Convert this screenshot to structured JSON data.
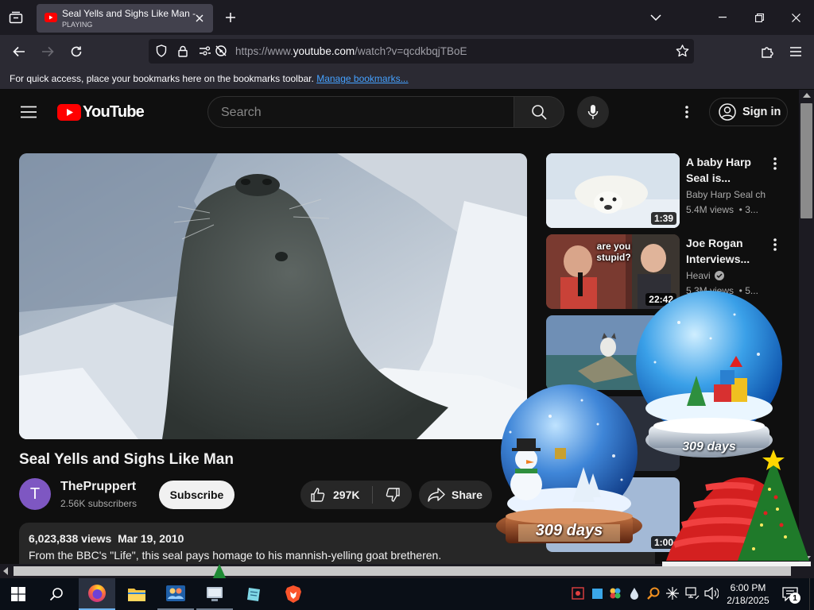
{
  "browser": {
    "tab": {
      "title": "Seal Yells and Sighs Like Man -",
      "status": "PLAYING"
    },
    "url": {
      "prefix": "https://www.",
      "domain": "youtube.com",
      "path": "/watch?v=qcdkbqjTBoE"
    },
    "bookmarks_bar": {
      "message": "For quick access, place your bookmarks here on the bookmarks toolbar.",
      "link": "Manage bookmarks..."
    }
  },
  "youtube": {
    "logo_text": "YouTube",
    "search": {
      "placeholder": "Search"
    },
    "sign_in": "Sign in",
    "video": {
      "title": "Seal Yells and Sighs Like Man",
      "channel": {
        "avatar_letter": "T",
        "name": "ThePruppert",
        "subscribers": "2.56K subscribers"
      },
      "subscribe": "Subscribe",
      "likes": "297K",
      "share": "Share",
      "views": "6,023,838 views",
      "date": "Mar 19, 2010",
      "description": "From the BBC's \"Life\", this seal pays homage to his mannish-yelling goat bretheren."
    },
    "recommendations": [
      {
        "title": "A baby Harp Seal is...",
        "channel": "Baby Harp Seal ch",
        "meta": "5.4M views  • 3...",
        "duration": "1:39"
      },
      {
        "title": "Joe Rogan Interviews...",
        "channel": "Heavi",
        "meta": "5.3M views  • 5...",
        "duration": "22:42",
        "overlay": "are you stupid?"
      },
      {
        "title": "",
        "channel": "",
        "meta": "",
        "duration": ""
      },
      {
        "duration": "1:00"
      }
    ]
  },
  "desktop_widgets": {
    "globe_small_days": "309 days",
    "globe_large_days": "309 days"
  },
  "taskbar": {
    "time": "6:00 PM",
    "date": "2/18/2025",
    "notification_count": "1"
  },
  "colors": {
    "yt_red": "#ff0000",
    "link_blue": "#45a1ff",
    "taskbar": "#0a0f17"
  }
}
